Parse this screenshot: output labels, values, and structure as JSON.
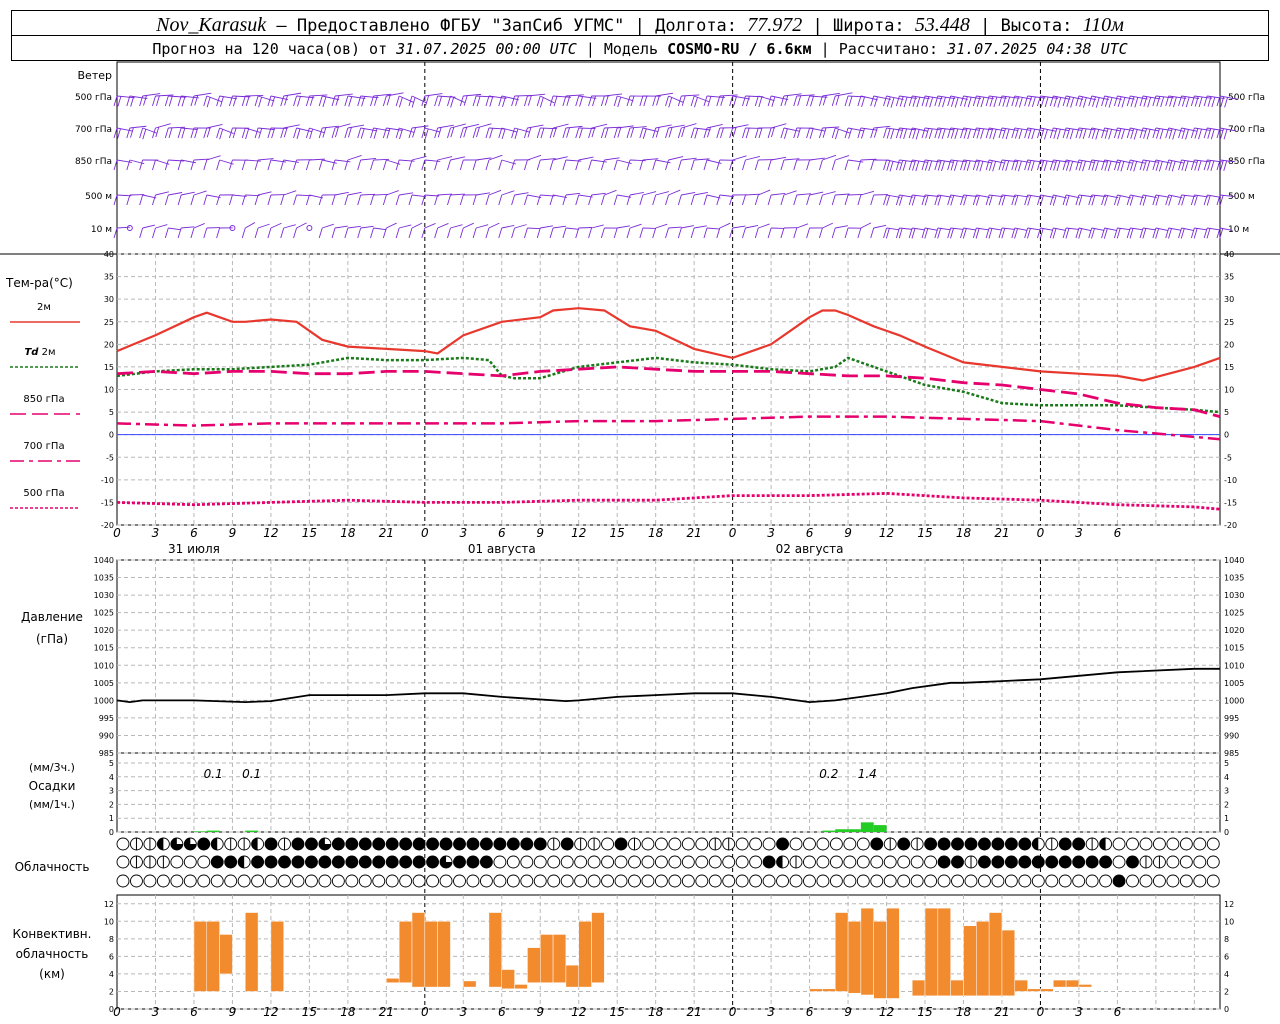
{
  "header": {
    "station": "Nov_Karasuk",
    "provider": "Предоставлено ФГБУ \"ЗапСиб УГМС\"",
    "longitude_label": "Долгота:",
    "longitude": "77.972",
    "latitude_label": "Широта:",
    "latitude": "53.448",
    "altitude_label": "Высота:",
    "altitude": "110м",
    "forecast_prefix": "Прогноз на 120 часа(ов) от",
    "forecast_from": "31.07.2025 00:00 UTC",
    "model_label": "Модель",
    "model": "COSMO-RU / 6.6км",
    "computed_label": "Рассчитано:",
    "computed": "31.07.2025 04:38 UTC"
  },
  "time_axis": {
    "hour_labels": [
      "0",
      "3",
      "6",
      "9",
      "12",
      "15",
      "18",
      "21",
      "0",
      "3",
      "6",
      "9",
      "12",
      "15",
      "18",
      "21",
      "0",
      "3",
      "6",
      "9",
      "12",
      "15",
      "18",
      "21",
      "0",
      "3",
      "6"
    ],
    "day_labels": [
      "31 июля",
      "01 августа",
      "02 августа"
    ],
    "day_label_hours": [
      6,
      30,
      54
    ]
  },
  "wind_panel": {
    "title": "Ветер",
    "levels": [
      "500 гПа",
      "700 гПа",
      "850 гПа",
      "500 м",
      "10 м"
    ],
    "color": "#7a2bd6"
  },
  "chart_data": [
    {
      "type": "line",
      "title": "Тем-ра(°С)",
      "ylim": [
        -20,
        40
      ],
      "yticks": [
        -20,
        -15,
        -10,
        -5,
        0,
        5,
        10,
        15,
        20,
        25,
        30,
        35,
        40
      ],
      "x_unit": "hours from 31.07.2025 00:00 UTC",
      "legend_placement": "left",
      "grid": true,
      "series": [
        {
          "name": "2м",
          "color": "#e8382e",
          "style": "solid",
          "x": [
            0,
            3,
            6,
            7,
            9,
            10,
            12,
            14,
            16,
            18,
            21,
            24,
            25,
            27,
            30,
            33,
            34,
            36,
            38,
            40,
            42,
            45,
            48,
            51,
            53,
            54,
            55,
            56,
            57,
            59,
            61,
            63,
            66,
            69,
            72,
            75,
            78,
            80,
            82,
            84,
            86
          ],
          "y": [
            18.5,
            22,
            26,
            27,
            25,
            25,
            25.5,
            25,
            21,
            19.5,
            19,
            18.5,
            18,
            22,
            25,
            26,
            27.5,
            28,
            27.5,
            24,
            23,
            19,
            17,
            20,
            24,
            26,
            27.5,
            27.5,
            26.5,
            24,
            22,
            19.5,
            16,
            15,
            14,
            13.5,
            13,
            12,
            13.5,
            15,
            17
          ]
        },
        {
          "name": "Td 2м",
          "color": "#1a7a1a",
          "style": "dotted",
          "x": [
            0,
            3,
            6,
            9,
            12,
            15,
            18,
            21,
            24,
            27,
            29,
            30,
            31,
            33,
            36,
            39,
            42,
            45,
            48,
            51,
            54,
            56,
            57,
            59,
            61,
            63,
            66,
            69,
            72,
            75,
            78,
            81,
            84,
            86
          ],
          "y": [
            13,
            14,
            14.5,
            14.5,
            15,
            15.5,
            17,
            16.5,
            16.5,
            17,
            16.5,
            13,
            12.5,
            12.5,
            15,
            16,
            17,
            16,
            15.5,
            14.5,
            14,
            15,
            17,
            15,
            13,
            11,
            9.5,
            7,
            6.5,
            6.5,
            6.5,
            6,
            5.5,
            5
          ]
        },
        {
          "name": "850 гПа",
          "color": "#e6006e",
          "style": "long-dash",
          "x": [
            0,
            3,
            6,
            9,
            12,
            15,
            18,
            21,
            24,
            27,
            30,
            33,
            36,
            39,
            42,
            45,
            48,
            51,
            54,
            57,
            60,
            63,
            66,
            69,
            72,
            75,
            78,
            81,
            84,
            86
          ],
          "y": [
            13.5,
            14,
            13.5,
            14,
            14,
            13.5,
            13.5,
            14,
            14,
            13.5,
            13,
            14,
            14.5,
            15,
            14.5,
            14,
            14,
            14,
            13.5,
            13,
            13,
            12.5,
            11.5,
            11,
            10,
            9,
            7,
            6,
            5.5,
            4
          ]
        },
        {
          "name": "700 гПа",
          "color": "#e6006e",
          "style": "dash-dot",
          "x": [
            0,
            6,
            12,
            18,
            24,
            30,
            36,
            42,
            48,
            54,
            60,
            66,
            72,
            78,
            84,
            86
          ],
          "y": [
            2.5,
            2,
            2.5,
            2.5,
            2.5,
            2.5,
            3,
            3,
            3.5,
            4,
            4,
            3.5,
            3,
            1,
            -0.5,
            -1
          ]
        },
        {
          "name": "500 гПа",
          "color": "#e6006e",
          "style": "dotted",
          "x": [
            0,
            6,
            12,
            18,
            24,
            30,
            36,
            42,
            48,
            54,
            60,
            66,
            72,
            78,
            84,
            86
          ],
          "y": [
            -15,
            -15.5,
            -15,
            -14.5,
            -15,
            -15,
            -14.5,
            -14.5,
            -13.5,
            -13.5,
            -13,
            -14,
            -14.5,
            -15.5,
            -16,
            -16.5
          ]
        }
      ]
    },
    {
      "type": "line",
      "title": "Давление",
      "ylabel": "(гПа)",
      "ylim": [
        985,
        1040
      ],
      "yticks": [
        985,
        990,
        995,
        1000,
        1005,
        1010,
        1015,
        1020,
        1025,
        1030,
        1035,
        1040
      ],
      "x_unit": "hours from 31.07.2025 00:00 UTC",
      "grid": true,
      "series": [
        {
          "color": "#000000",
          "x": [
            0,
            1,
            2,
            6,
            10,
            12,
            15,
            18,
            21,
            24,
            27,
            30,
            35,
            36,
            39,
            42,
            45,
            48,
            51,
            54,
            56,
            58,
            60,
            62,
            65,
            66,
            69,
            72,
            75,
            78,
            84,
            86
          ],
          "y": [
            1000,
            999.5,
            1000,
            1000,
            999.5,
            999.8,
            1001.5,
            1001.5,
            1001.5,
            1002,
            1002,
            1001,
            999.8,
            1000,
            1001,
            1001.5,
            1002,
            1002,
            1001,
            999.5,
            1000,
            1001,
            1002,
            1003.5,
            1005,
            1005,
            1005.5,
            1006,
            1007,
            1008,
            1009,
            1009
          ]
        }
      ]
    },
    {
      "type": "bar",
      "title": "Осадки",
      "ylabel_top": "(мм/3ч.)",
      "ylabel_bottom": "(мм/1ч.)",
      "ylim": [
        0,
        5
      ],
      "yticks": [
        0,
        1,
        2,
        3,
        4,
        5
      ],
      "color": "#22cc22",
      "hours": [
        6,
        7,
        10,
        55,
        56,
        57,
        58,
        59
      ],
      "values": [
        0.05,
        0.1,
        0.1,
        0.1,
        0.2,
        0.2,
        0.7,
        0.5
      ],
      "totals_3h": [
        {
          "hour": 7.5,
          "label": "0.1"
        },
        {
          "hour": 10.5,
          "label": "0.1"
        },
        {
          "hour": 55.5,
          "label": "0.2"
        },
        {
          "hour": 58.5,
          "label": "1.4"
        }
      ]
    },
    {
      "type": "bar",
      "title": "Конвективн. облачность",
      "ylabel": "(км)",
      "ylim": [
        0,
        13
      ],
      "yticks": [
        0,
        2,
        4,
        6,
        8,
        10,
        12
      ],
      "color": "#f28a2e",
      "bars": [
        {
          "h": 6,
          "base": 2,
          "top": 10
        },
        {
          "h": 7,
          "base": 2,
          "top": 10
        },
        {
          "h": 8,
          "base": 4,
          "top": 8.5
        },
        {
          "h": 10,
          "base": 2,
          "top": 11
        },
        {
          "h": 12,
          "base": 2,
          "top": 10
        },
        {
          "h": 21,
          "base": 3,
          "top": 3.5
        },
        {
          "h": 22,
          "base": 3,
          "top": 10
        },
        {
          "h": 23,
          "base": 2.5,
          "top": 11
        },
        {
          "h": 24,
          "base": 2.5,
          "top": 10
        },
        {
          "h": 25,
          "base": 2.5,
          "top": 10
        },
        {
          "h": 27,
          "base": 2.5,
          "top": 3.2
        },
        {
          "h": 29,
          "base": 2.5,
          "top": 11
        },
        {
          "h": 30,
          "base": 2.3,
          "top": 4.5
        },
        {
          "h": 31,
          "base": 2.3,
          "top": 2.8
        },
        {
          "h": 32,
          "base": 3,
          "top": 7
        },
        {
          "h": 33,
          "base": 3,
          "top": 8.5
        },
        {
          "h": 34,
          "base": 3,
          "top": 8.5
        },
        {
          "h": 35,
          "base": 2.5,
          "top": 5
        },
        {
          "h": 36,
          "base": 2.5,
          "top": 10
        },
        {
          "h": 37,
          "base": 3,
          "top": 11
        },
        {
          "h": 54,
          "base": 2,
          "top": 2.3
        },
        {
          "h": 55,
          "base": 2,
          "top": 2.3
        },
        {
          "h": 56,
          "base": 2,
          "top": 11
        },
        {
          "h": 57,
          "base": 1.8,
          "top": 10
        },
        {
          "h": 58,
          "base": 1.6,
          "top": 11.5
        },
        {
          "h": 59,
          "base": 1.2,
          "top": 10
        },
        {
          "h": 60,
          "base": 1.2,
          "top": 11.5
        },
        {
          "h": 62,
          "base": 1.5,
          "top": 3.3
        },
        {
          "h": 63,
          "base": 1.5,
          "top": 11.5
        },
        {
          "h": 64,
          "base": 1.5,
          "top": 11.5
        },
        {
          "h": 65,
          "base": 1.5,
          "top": 3.3
        },
        {
          "h": 66,
          "base": 1.5,
          "top": 9.5
        },
        {
          "h": 67,
          "base": 1.5,
          "top": 10
        },
        {
          "h": 68,
          "base": 1.5,
          "top": 11
        },
        {
          "h": 69,
          "base": 1.5,
          "top": 9
        },
        {
          "h": 70,
          "base": 2,
          "top": 3.3
        },
        {
          "h": 71,
          "base": 2,
          "top": 2.3
        },
        {
          "h": 72,
          "base": 2,
          "top": 2.3
        },
        {
          "h": 73,
          "base": 2.5,
          "top": 3.3
        },
        {
          "h": 74,
          "base": 2.5,
          "top": 3.3
        },
        {
          "h": 75,
          "base": 2.5,
          "top": 2.8
        }
      ]
    }
  ],
  "cloud_panel": {
    "title": "Облачность",
    "rows": [
      "0112334211241443444444444444444414110410000011000400000041414444444421441200000000",
      "0111000442444444444444443444000000000000000000004210000000000441444444444404110000",
      "0000000000000000000000000000000000000000000000000000000000000000000000000040000000"
    ]
  }
}
